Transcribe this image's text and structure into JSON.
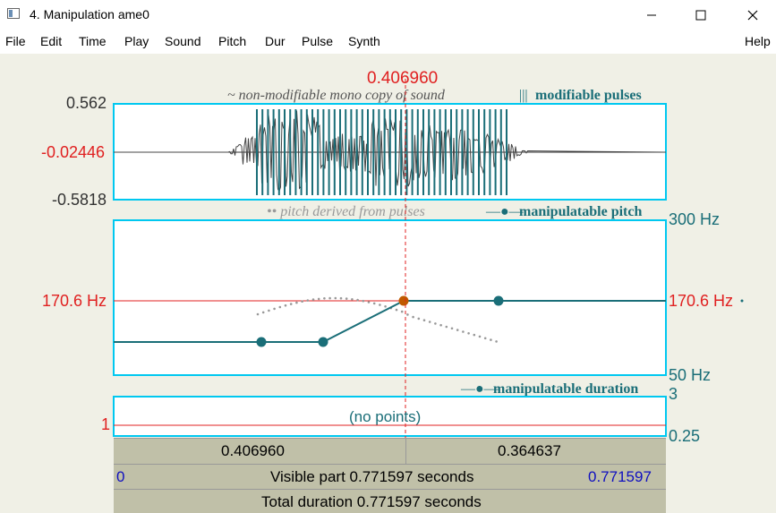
{
  "window": {
    "title": "4. Manipulation ame0",
    "minimize_icon": "minimize-icon",
    "maximize_icon": "maximize-icon",
    "close_icon": "close-icon"
  },
  "menu": {
    "items": [
      "File",
      "Edit",
      "Time",
      "Play",
      "Sound",
      "Pitch",
      "Dur",
      "Pulse",
      "Synth"
    ],
    "help": "Help"
  },
  "cursor": {
    "time_label": "0.406960"
  },
  "sound_panel": {
    "ymax": "0.562",
    "cursor_value": "-0.02446",
    "ymin": "-0.5818",
    "legend_sound": "~ non-modifiable mono copy of sound",
    "legend_pulses_glyph": "|||",
    "legend_pulses": "modifiable pulses"
  },
  "pitch_panel": {
    "legend_derived": "•• pitch derived from pulses",
    "legend_manip_glyph": "—●—",
    "legend_manip": "manipulatable pitch",
    "top": "300 Hz",
    "bottom": "50 Hz",
    "cursor_left": "170.6 Hz",
    "cursor_right": "170.6 Hz"
  },
  "duration_panel": {
    "legend_glyph": "—●—",
    "legend": "manipulatable duration",
    "top": "3",
    "bottom": "0.25",
    "cursor_left": "1",
    "empty_text": "(no points)"
  },
  "bottom_bars": {
    "left_segment": "0.406960",
    "right_segment": "0.364637",
    "visible_start": "0",
    "visible_text": "Visible part 0.771597 seconds",
    "visible_end": "0.771597",
    "total_text": "Total duration 0.771597 seconds"
  },
  "colors": {
    "panel_border": "#00c8f0",
    "cursor": "#e02020",
    "pulse": "#1a6e78",
    "pitch_line": "#1a6e78",
    "pitch_point_selected": "#c05a00",
    "text_teal": "#1a6e78",
    "blue": "#1010c0"
  }
}
